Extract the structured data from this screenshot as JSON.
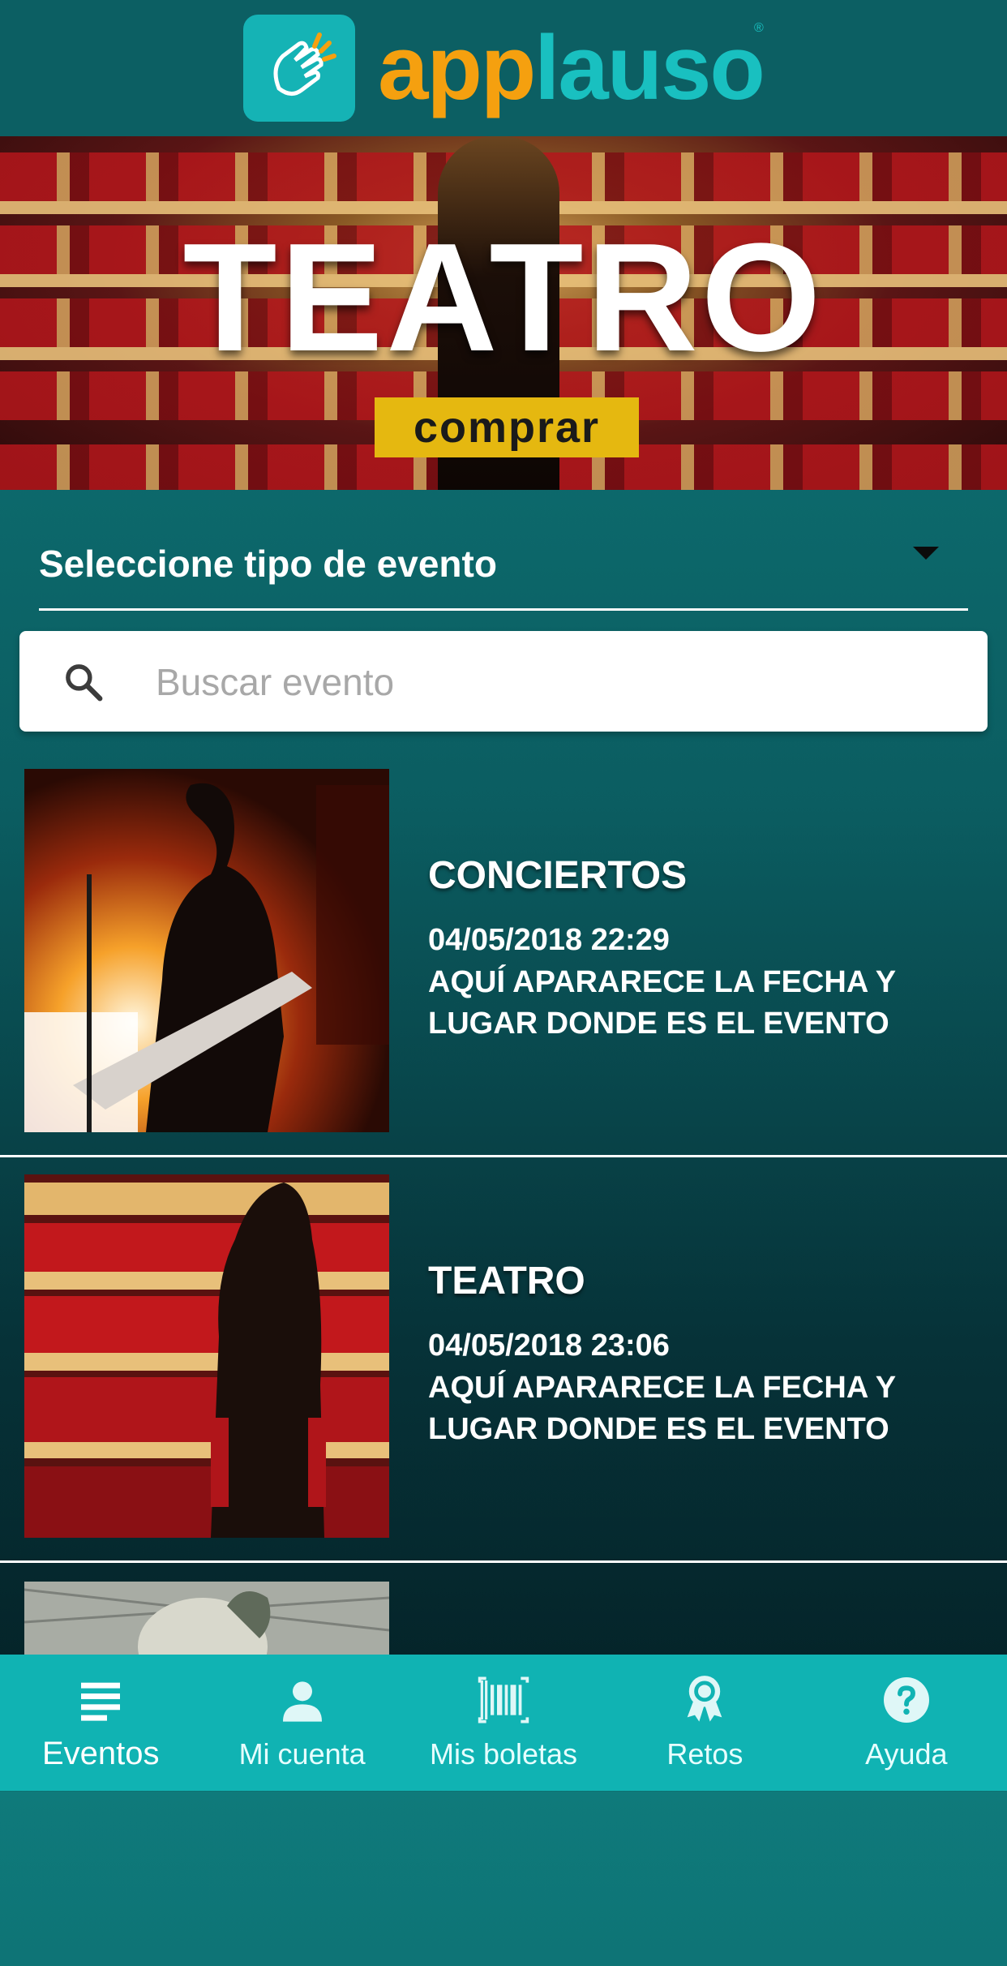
{
  "header": {
    "logo_part1": "app",
    "logo_part2": "lauso",
    "registered": "®"
  },
  "banner": {
    "title": "TEATRO",
    "button_label": "comprar"
  },
  "filter": {
    "selected": "Seleccione tipo de evento"
  },
  "search": {
    "placeholder": "Buscar evento",
    "value": ""
  },
  "events": [
    {
      "title": "CONCIERTOS",
      "date": "04/05/2018 22:29",
      "description": "AQUÍ APARARECE LA FECHA Y LUGAR DONDE ES EL EVENTO"
    },
    {
      "title": "TEATRO",
      "date": "04/05/2018 23:06",
      "description": "AQUÍ APARARECE LA FECHA Y LUGAR DONDE ES EL EVENTO"
    }
  ],
  "nav": [
    {
      "label": "Eventos",
      "icon": "list-icon",
      "active": true
    },
    {
      "label": "Mi cuenta",
      "icon": "person-icon",
      "active": false
    },
    {
      "label": "Mis boletas",
      "icon": "barcode-icon",
      "active": false
    },
    {
      "label": "Retos",
      "icon": "award-icon",
      "active": false
    },
    {
      "label": "Ayuda",
      "icon": "help-icon",
      "active": false
    }
  ],
  "colors": {
    "header_bg": "#0c5f63",
    "accent_orange": "#f5a00f",
    "accent_teal": "#19c0c0",
    "nav_bg": "#10b3b3",
    "buy_yellow": "#e5b810"
  }
}
